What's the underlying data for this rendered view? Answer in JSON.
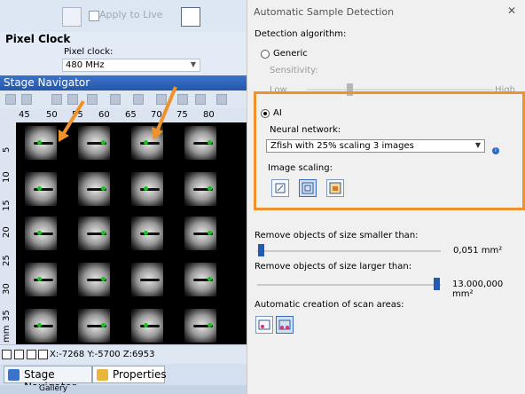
{
  "left_app": {
    "apply_label": "Apply to Live",
    "pixel_clock_title": "Pixel Clock",
    "pixel_clock_label": "Pixel clock:",
    "pixel_clock_value": "480 MHz",
    "stage_navigator_title": "Stage Navigator",
    "x_ticks": [
      "45",
      "50",
      "55",
      "60",
      "65",
      "70",
      "75",
      "80"
    ],
    "y_ticks": [
      "5",
      "10",
      "15",
      "20",
      "25",
      "30",
      "35"
    ],
    "y_unit": "mm",
    "coords": "X:-7268 Y:-5700 Z:6953",
    "tabs": [
      {
        "label": "Stage Navigator"
      },
      {
        "label": "Properties"
      }
    ],
    "bottom_tab_label": "Gallery"
  },
  "dialog": {
    "title": "Automatic Sample Detection",
    "close_symbol": "✕",
    "detection_algorithm_label": "Detection algorithm:",
    "generic_label": "Generic",
    "sensitivity_label": "Sensitivity:",
    "low_label": "Low",
    "high_label": "High",
    "ai_label": "AI",
    "neural_network_label": "Neural network:",
    "neural_network_value": "Zfish with 25% scaling 3 images",
    "info_symbol": "i",
    "image_scaling_label": "Image scaling:",
    "remove_smaller_label": "Remove objects of size smaller than:",
    "remove_smaller_value": "0,051 mm²",
    "remove_larger_label": "Remove objects of size larger than:",
    "remove_larger_value": "13.000,000 mm²",
    "auto_scan_label": "Automatic creation of scan areas:",
    "selected_algorithm": "AI",
    "selected_scaling_index": 1,
    "highlight_color": "#f0922a",
    "accent_color": "#1f5ab8"
  }
}
